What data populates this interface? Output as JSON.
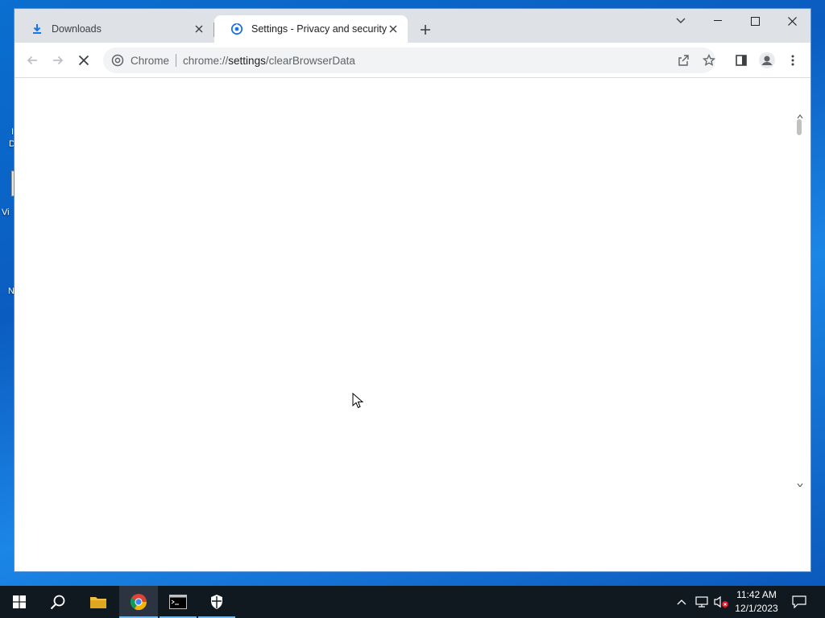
{
  "desktop": {
    "fragments": [
      "I",
      "D",
      "Vi",
      "N"
    ]
  },
  "browser": {
    "tabs": [
      {
        "title": "Downloads",
        "icon": "download-icon",
        "active": false
      },
      {
        "title": "Settings - Privacy and security",
        "icon": "chrome-settings-icon",
        "active": true
      }
    ],
    "omnibox": {
      "chip_label": "Chrome",
      "url_prefix": "chrome://",
      "url_host": "settings",
      "url_path": "/clearBrowserData"
    },
    "loading": true
  },
  "taskbar": {
    "items": [
      "start-icon",
      "search-icon",
      "file-explorer-icon",
      "chrome-icon",
      "terminal-icon",
      "shield-icon"
    ],
    "clock": {
      "time": "11:42 AM",
      "date": "12/1/2023"
    }
  },
  "colors": {
    "accent": "#1a73e8",
    "taskbar": "#101820",
    "tabstrip": "#dee1e6"
  }
}
